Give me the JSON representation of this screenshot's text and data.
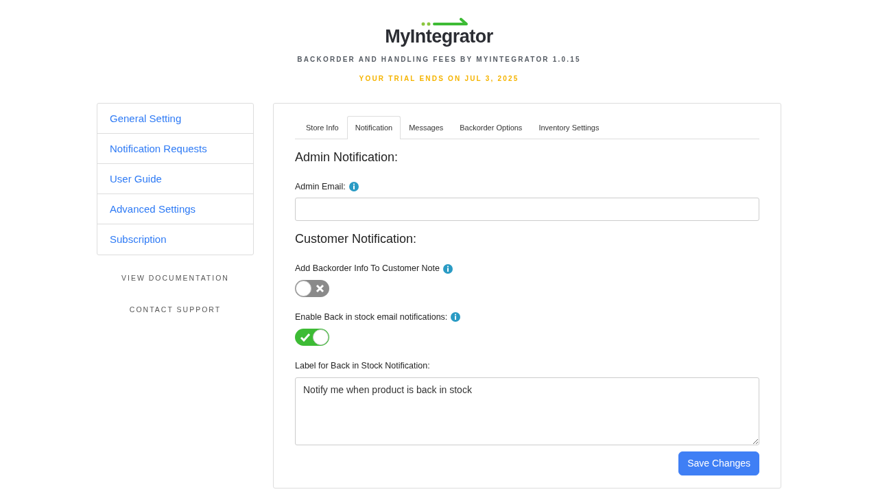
{
  "header": {
    "logo": "MyIntegrator",
    "subtitle": "BACKORDER AND HANDLING FEES BY MYINTEGRATOR 1.0.15",
    "trial": "YOUR TRIAL ENDS ON JUL 3, 2025"
  },
  "sidebar": {
    "items": [
      {
        "label": "General Setting"
      },
      {
        "label": "Notification Requests"
      },
      {
        "label": "User Guide"
      },
      {
        "label": "Advanced Settings"
      },
      {
        "label": "Subscription"
      }
    ],
    "links": [
      "VIEW DOCUMENTATION",
      "CONTACT SUPPORT"
    ]
  },
  "tabs": [
    {
      "label": "Store Info",
      "selected": false
    },
    {
      "label": "Notification",
      "selected": true
    },
    {
      "label": "Messages",
      "selected": false
    },
    {
      "label": "Backorder Options",
      "selected": false
    },
    {
      "label": "Inventory Settings",
      "selected": false
    }
  ],
  "fields": [
    {
      "kind": "heading",
      "label": "Admin Notification:"
    },
    {
      "kind": "text",
      "label": "Admin Email:",
      "info": true
    },
    {
      "kind": "heading",
      "label": "Customer Notification:"
    },
    {
      "kind": "toggle",
      "label": "Add Backorder Info To Customer Note",
      "info": true,
      "on": false
    },
    {
      "kind": "toggle",
      "label": "Enable Back in stock email notifications:",
      "info": true,
      "on": true
    },
    {
      "kind": "textarea",
      "label": "Label for Back in Stock Notification:",
      "value": "Notify me when product is back in stock"
    }
  ],
  "save_button": "Save Changes"
}
